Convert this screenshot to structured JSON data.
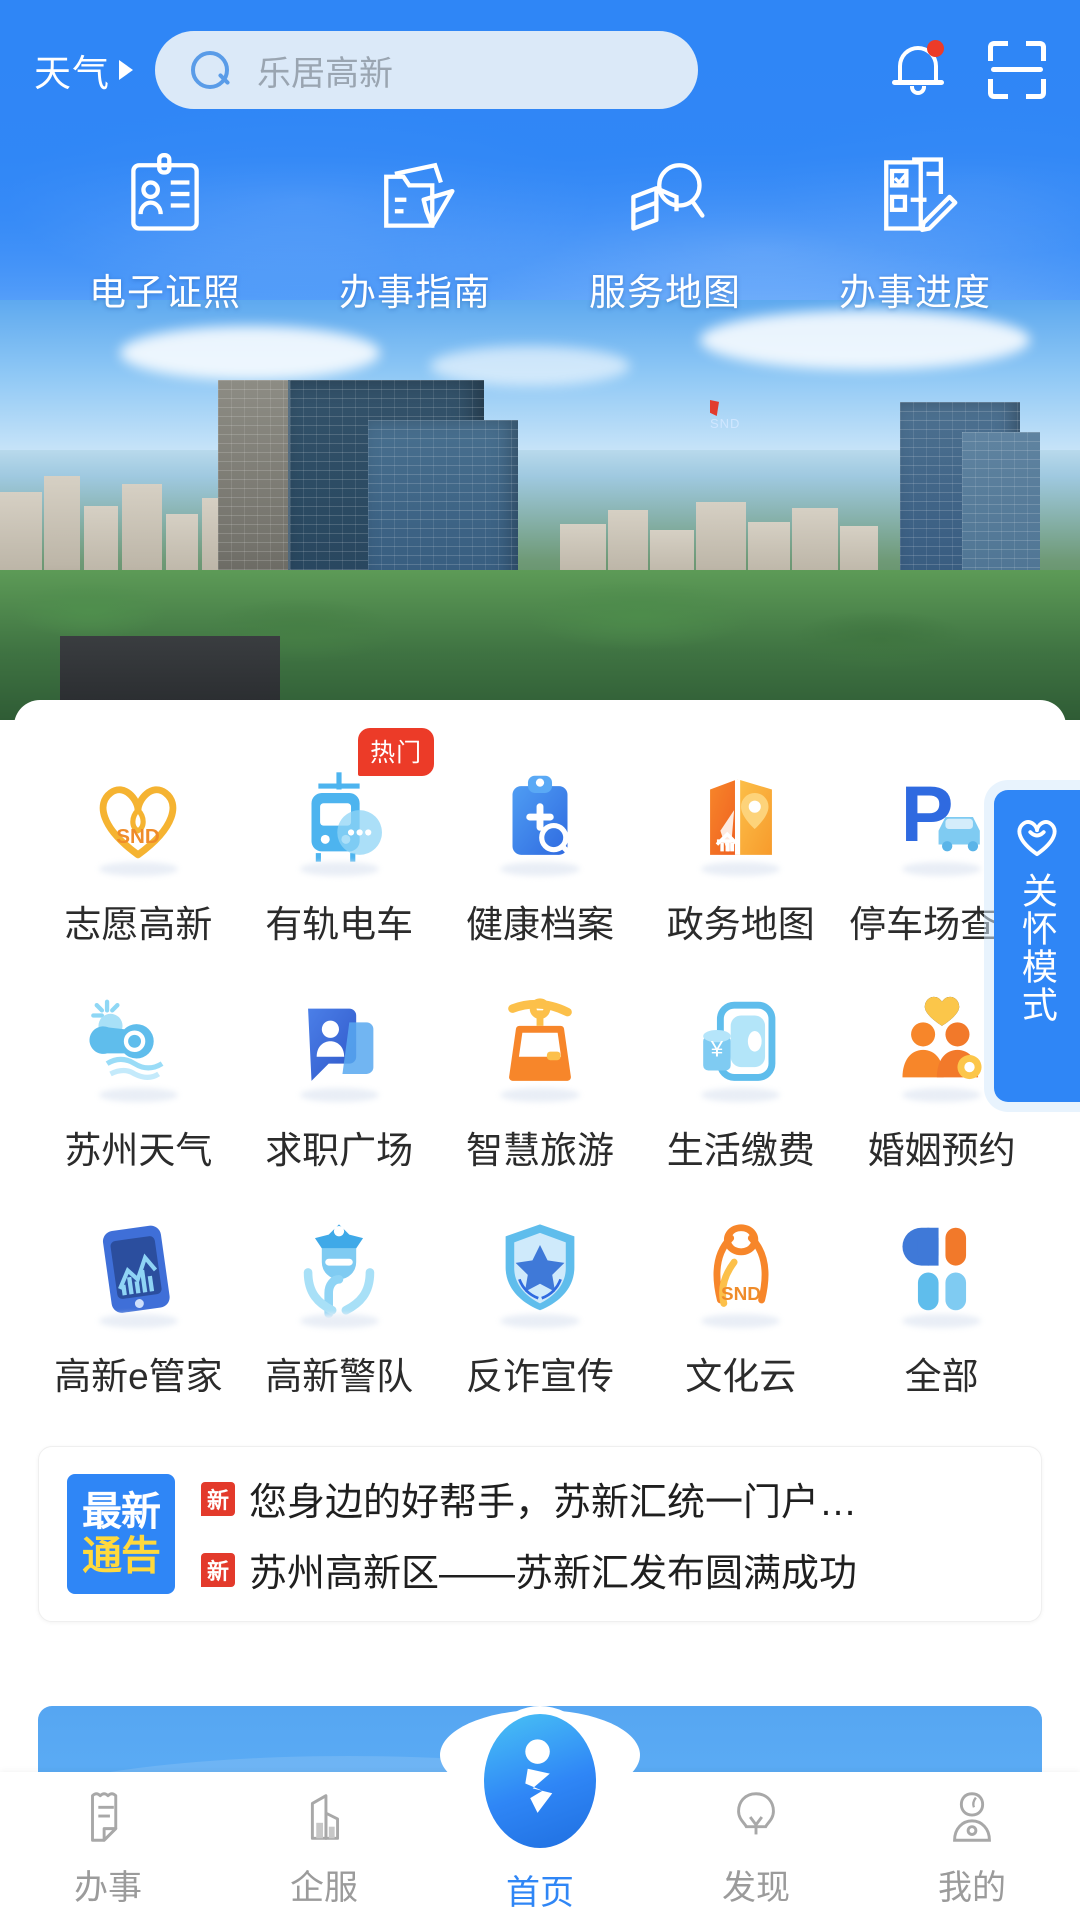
{
  "header": {
    "weather_label": "天气",
    "search_placeholder": "乐居高新",
    "bell_icon": "bell-icon",
    "scan_icon": "scan-icon",
    "has_notification_dot": true,
    "accent_color": "#2f86f6"
  },
  "quick_links": [
    {
      "label": "电子证照",
      "icon": "id-card-icon"
    },
    {
      "label": "办事指南",
      "icon": "folder-send-icon"
    },
    {
      "label": "服务地图",
      "icon": "map-search-icon"
    },
    {
      "label": "办事进度",
      "icon": "document-pen-icon"
    }
  ],
  "services": [
    {
      "label": "志愿高新",
      "icon": "heart-snd-icon",
      "badge": ""
    },
    {
      "label": "有轨电车",
      "icon": "tram-icon",
      "badge": "热门"
    },
    {
      "label": "健康档案",
      "icon": "health-record-icon",
      "badge": ""
    },
    {
      "label": "政务地图",
      "icon": "gov-map-icon",
      "badge": ""
    },
    {
      "label": "停车场查询",
      "icon": "parking-icon",
      "badge": ""
    },
    {
      "label": "苏州天气",
      "icon": "weather-cloud-icon",
      "badge": ""
    },
    {
      "label": "求职广场",
      "icon": "job-chat-icon",
      "badge": ""
    },
    {
      "label": "智慧旅游",
      "icon": "cable-car-icon",
      "badge": ""
    },
    {
      "label": "生活缴费",
      "icon": "payment-icon",
      "badge": ""
    },
    {
      "label": "婚姻预约",
      "icon": "marriage-icon",
      "badge": ""
    },
    {
      "label": "高新e管家",
      "icon": "phone-chart-icon",
      "badge": ""
    },
    {
      "label": "高新警队",
      "icon": "police-icon",
      "badge": ""
    },
    {
      "label": "反诈宣传",
      "icon": "shield-star-icon",
      "badge": ""
    },
    {
      "label": "文化云",
      "icon": "culture-snd-icon",
      "badge": ""
    },
    {
      "label": "全部",
      "icon": "all-apps-icon",
      "badge": ""
    }
  ],
  "news": {
    "badge_line1": "最新",
    "badge_line2": "通告",
    "tag": "新",
    "items": [
      {
        "tag": "新",
        "text": "您身边的好帮手，苏新汇统一门户…"
      },
      {
        "tag": "新",
        "text": "苏州高新区——苏新汇发布圆满成功"
      }
    ]
  },
  "care_button": {
    "text": "关怀模式",
    "icon": "heart-smile-icon"
  },
  "bottom_nav": {
    "items": [
      {
        "label": "办事",
        "icon": "document-edit-icon",
        "active": false
      },
      {
        "label": "企服",
        "icon": "building-icon",
        "active": false
      },
      {
        "label": "首页",
        "icon": "home-person-icon",
        "active": true
      },
      {
        "label": "发现",
        "icon": "bulb-icon",
        "active": false
      },
      {
        "label": "我的",
        "icon": "user-icon",
        "active": false
      }
    ]
  },
  "background": {
    "photo_description": "苏州高新区城市天际线",
    "brand_mark": "SND"
  }
}
